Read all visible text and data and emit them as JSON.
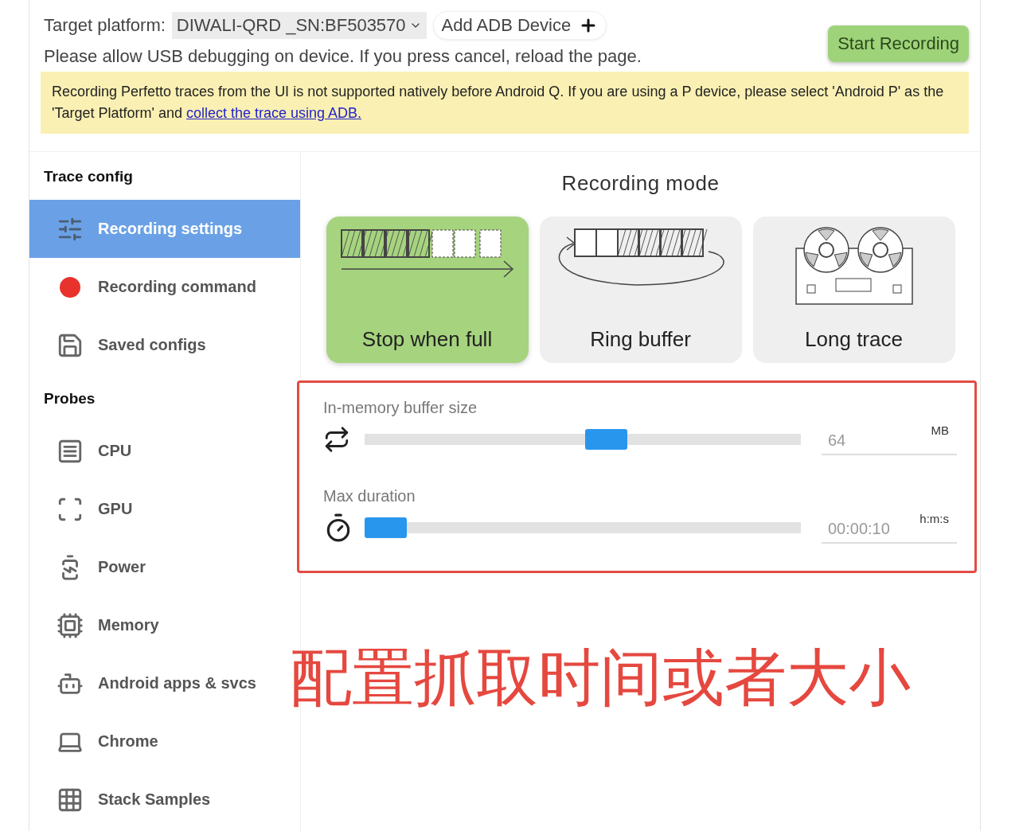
{
  "header": {
    "platform_label": "Target platform:",
    "platform_value": "DIWALI-QRD _SN:BF503570",
    "add_device": "Add ADB Device",
    "hint": "Please allow USB debugging on device. If you press cancel, reload the page.",
    "start_button": "Start Recording"
  },
  "warning": {
    "text": "Recording Perfetto traces from the UI is not supported natively before Android Q. If you are using a P device, please select 'Android P' as the 'Target Platform' and ",
    "link": "collect the trace using ADB."
  },
  "sidebar": {
    "sections": [
      {
        "title": "Trace config",
        "items": [
          {
            "label": "Recording settings",
            "selected": true
          },
          {
            "label": "Recording command",
            "selected": false
          },
          {
            "label": "Saved configs",
            "selected": false
          }
        ]
      },
      {
        "title": "Probes",
        "items": [
          {
            "label": "CPU",
            "selected": false
          },
          {
            "label": "GPU",
            "selected": false
          },
          {
            "label": "Power",
            "selected": false
          },
          {
            "label": "Memory",
            "selected": false
          },
          {
            "label": "Android apps & svcs",
            "selected": false
          },
          {
            "label": "Chrome",
            "selected": false
          },
          {
            "label": "Stack Samples",
            "selected": false
          }
        ]
      }
    ]
  },
  "recording_mode": {
    "title": "Recording mode",
    "modes": [
      {
        "kind": "stop",
        "label": "Stop when full",
        "selected": true
      },
      {
        "kind": "ring",
        "label": "Ring buffer",
        "selected": false
      },
      {
        "kind": "long",
        "label": "Long trace",
        "selected": false
      }
    ]
  },
  "sliders": [
    {
      "label": "In-memory buffer size",
      "level": 0.56,
      "value": "64",
      "unit": "MB"
    },
    {
      "label": "Max duration",
      "level": 0,
      "value": "00:00:10",
      "unit": "h:m:s"
    }
  ],
  "annotation": {
    "text": "配置抓取时间或者大小"
  }
}
